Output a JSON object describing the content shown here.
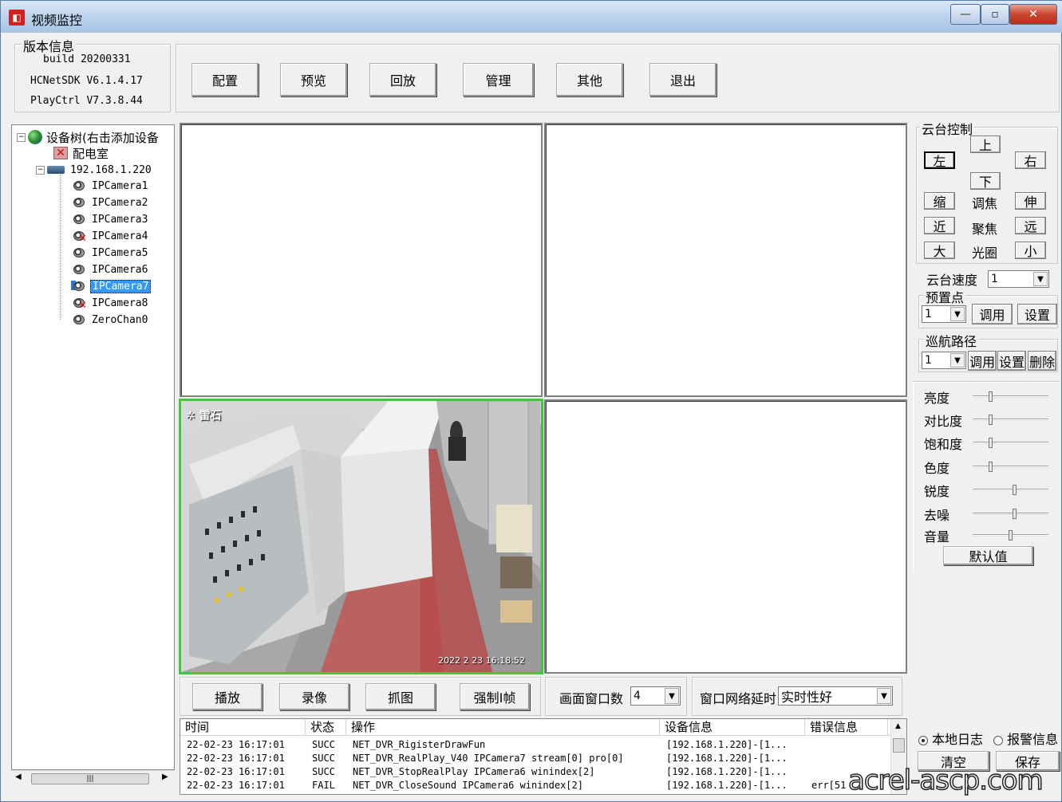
{
  "window": {
    "title": "视频监控",
    "minimize": "—",
    "maximize": "▫",
    "close": "✕"
  },
  "version": {
    "group_title": "版本信息",
    "build": "build 20200331",
    "sdk": "HCNetSDK V6.1.4.17",
    "playctrl": "PlayCtrl V7.3.8.44"
  },
  "toolbar": {
    "config": "配置",
    "preview": "预览",
    "playback": "回放",
    "manage": "管理",
    "other": "其他",
    "exit": "退出"
  },
  "tree": {
    "root": "设备树(右击添加设备",
    "room": "配电室",
    "device": "192.168.1.220",
    "cameras": [
      {
        "label": "IPCamera1",
        "status": "ok"
      },
      {
        "label": "IPCamera2",
        "status": "ok"
      },
      {
        "label": "IPCamera3",
        "status": "ok"
      },
      {
        "label": "IPCamera4",
        "status": "error"
      },
      {
        "label": "IPCamera5",
        "status": "ok"
      },
      {
        "label": "IPCamera6",
        "status": "ok"
      },
      {
        "label": "IPCamera7",
        "status": "playing",
        "selected": true
      },
      {
        "label": "IPCamera8",
        "status": "error"
      },
      {
        "label": "ZeroChan0",
        "status": "ok"
      }
    ]
  },
  "video": {
    "osd_logo": "雷石",
    "osd_timestamp": "2022 2 23 16:18:52",
    "active_border_color": "#3ec83e"
  },
  "bottom_bar": {
    "play": "播放",
    "record": "录像",
    "capture": "抓图",
    "force_iframe": "强制I帧",
    "window_count_label": "画面窗口数",
    "window_count_value": "4",
    "latency_label": "窗口网络延时",
    "latency_value": "实时性好"
  },
  "ptz": {
    "group_title": "云台控制",
    "up": "上",
    "down": "下",
    "left": "左",
    "right": "右",
    "zoom_in": "缩",
    "zoom_label": "调焦",
    "zoom_out": "伸",
    "focus_near": "近",
    "focus_label": "聚焦",
    "focus_far": "远",
    "iris_large": "大",
    "iris_label": "光圈",
    "iris_small": "小",
    "speed_label": "云台速度",
    "speed_value": "1",
    "preset_title": "预置点",
    "preset_value": "1",
    "preset_call": "调用",
    "preset_set": "设置",
    "cruise_title": "巡航路径",
    "cruise_value": "1",
    "cruise_call": "调用",
    "cruise_set": "设置",
    "cruise_delete": "删除"
  },
  "image_adjust": {
    "brightness": {
      "label": "亮度",
      "level": 0.22
    },
    "contrast": {
      "label": "对比度",
      "level": 0.22
    },
    "saturation": {
      "label": "饱和度",
      "level": 0.22
    },
    "hue": {
      "label": "色度",
      "level": 0.22
    },
    "sharpness": {
      "label": "锐度",
      "level": 0.55
    },
    "denoise": {
      "label": "去噪",
      "level": 0.55
    },
    "volume": {
      "label": "音量",
      "level": 0.5
    },
    "default_button": "默认值"
  },
  "log": {
    "headers": [
      "时间",
      "状态",
      "操作",
      "设备信息",
      "错误信息"
    ],
    "rows": [
      [
        "22-02-23 16:17:01",
        "SUCC",
        "NET_DVR_RigisterDrawFun",
        "[192.168.1.220]-[1...",
        ""
      ],
      [
        "22-02-23 16:17:01",
        "SUCC",
        "NET_DVR_RealPlay_V40 IPCamera7 stream[0] pro[0]",
        "[192.168.1.220]-[1...",
        ""
      ],
      [
        "22-02-23 16:17:01",
        "SUCC",
        "NET_DVR_StopRealPlay IPCamera6 winindex[2]",
        "[192.168.1.220]-[1...",
        ""
      ],
      [
        "22-02-23 16:17:01",
        "FAIL",
        "NET_DVR_CloseSound IPCamera6 winindex[2]",
        "[192.168.1.220]-[1...",
        "err[51"
      ]
    ],
    "local_log": "本地日志",
    "alarm_info": "报警信息",
    "clear": "清空",
    "save": "保存"
  },
  "watermark": "acrel-ascp.com"
}
